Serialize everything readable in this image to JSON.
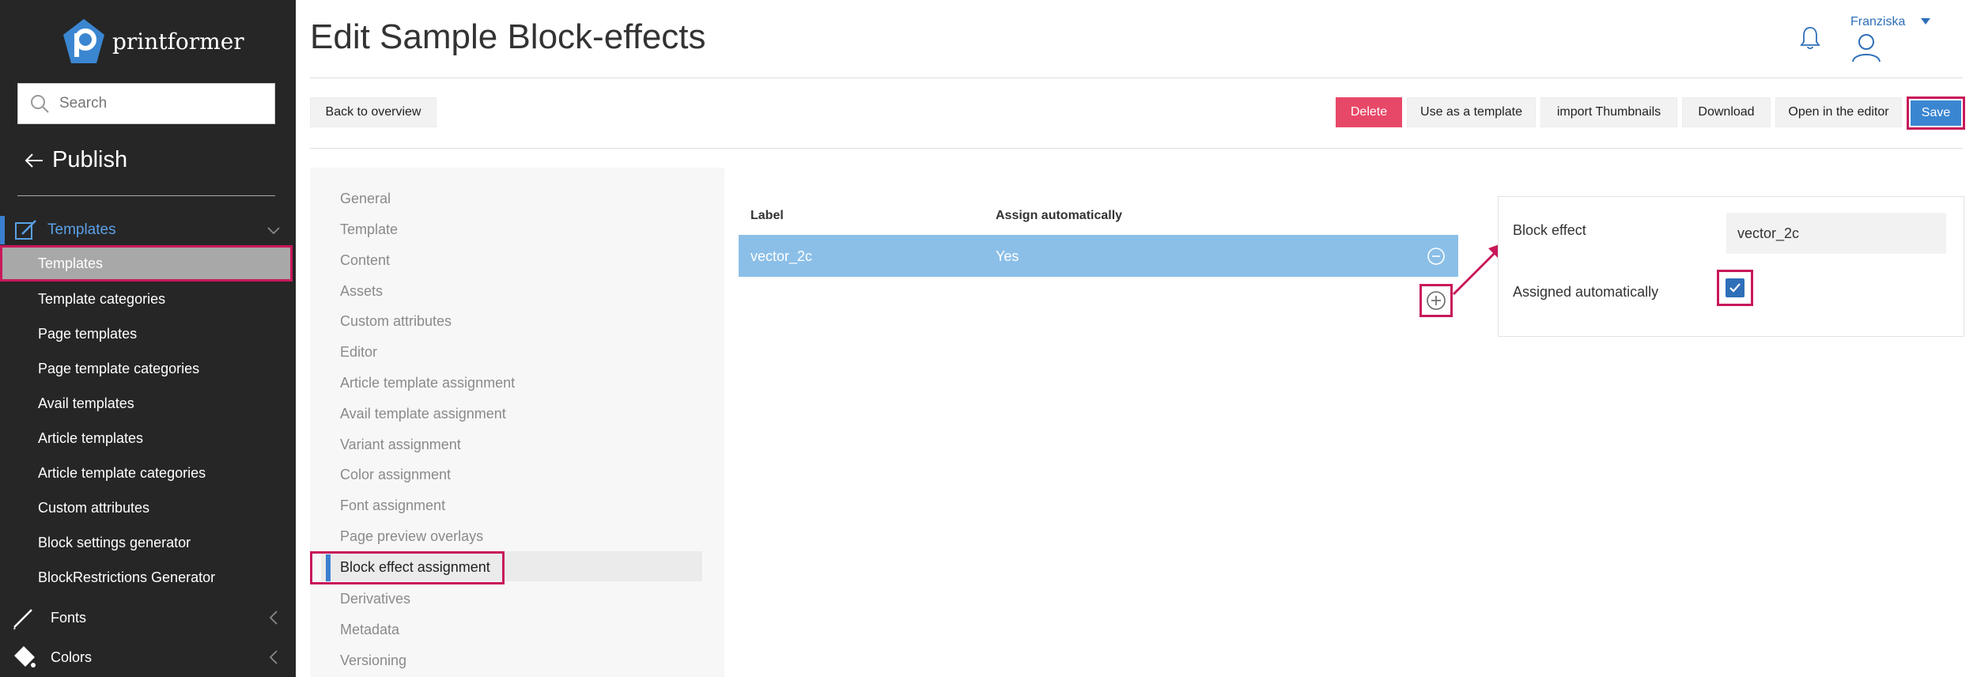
{
  "brand": {
    "name": "printformer"
  },
  "search": {
    "placeholder": "Search"
  },
  "sidebar": {
    "back_label": "Publish",
    "group_label": "Templates",
    "active_item": "Templates",
    "items": [
      "Template categories",
      "Page templates",
      "Page template categories",
      "Avail templates",
      "Article templates",
      "Article template categories",
      "Custom attributes",
      "Block settings generator",
      "BlockRestrictions Generator"
    ],
    "fonts_label": "Fonts",
    "colors_label": "Colors"
  },
  "page": {
    "title": "Edit Sample Block-effects"
  },
  "user": {
    "name": "Franziska"
  },
  "toolbar": {
    "back": "Back to overview",
    "delete": "Delete",
    "use_template": "Use as a template",
    "import_thumbs": "import Thumbnails",
    "download": "Download",
    "open_editor": "Open in the editor",
    "save": "Save"
  },
  "menu": {
    "items": [
      "General",
      "Template",
      "Content",
      "Assets",
      "Custom attributes",
      "Editor",
      "Article template assignment",
      "Avail template assignment",
      "Variant assignment",
      "Color assignment",
      "Font assignment",
      "Page preview overlays"
    ],
    "active": "Block effect assignment",
    "after": [
      "Derivatives",
      "Metadata",
      "Versioning"
    ]
  },
  "table": {
    "headers": {
      "label": "Label",
      "assign": "Assign automatically"
    },
    "rows": [
      {
        "label": "vector_2c",
        "assign": "Yes"
      }
    ]
  },
  "detail": {
    "block_effect_label": "Block effect",
    "block_effect_value": "vector_2c",
    "assigned_label": "Assigned automatically",
    "assigned_checked": true
  },
  "colors": {
    "sidebar_bg": "#262626",
    "accent_blue": "#3b86d1",
    "delete_red": "#e84867",
    "highlight": "#c8185a",
    "row_blue": "#8bbfe7"
  }
}
